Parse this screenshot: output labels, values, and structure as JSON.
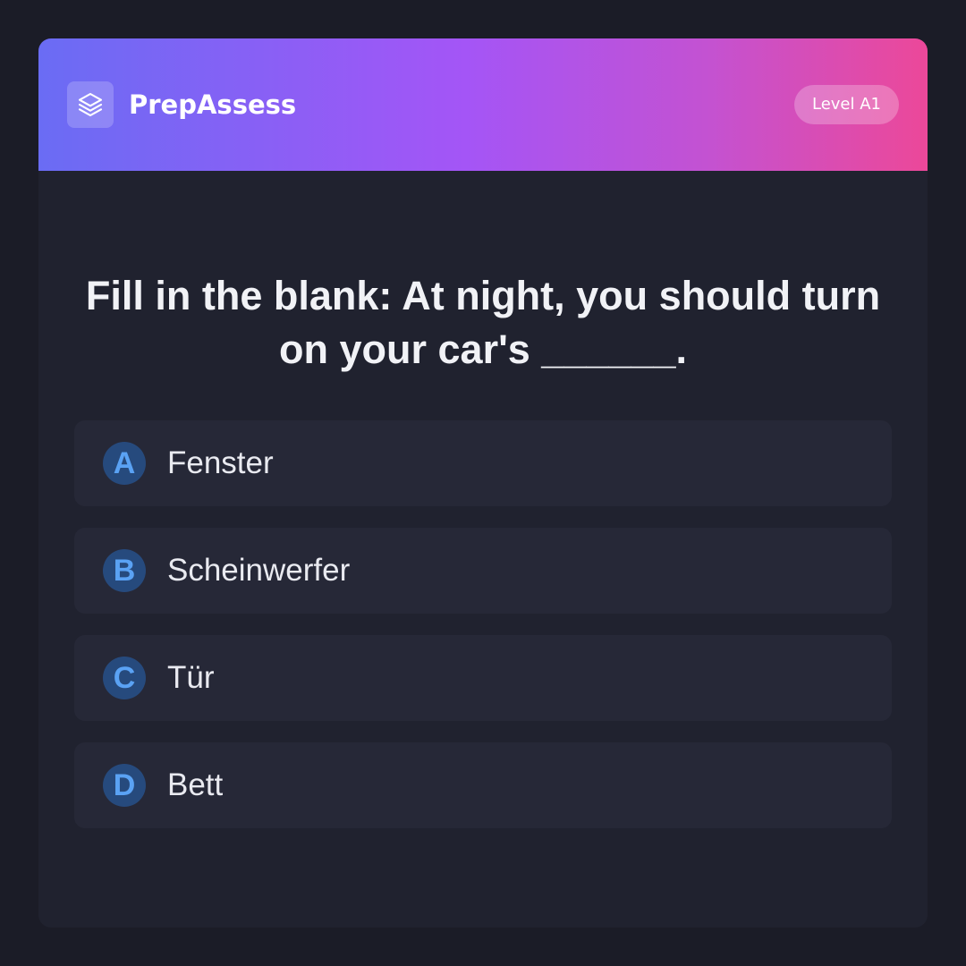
{
  "header": {
    "app_name": "PrepAssess",
    "logo_icon": "layers-icon",
    "level_badge": "Level A1"
  },
  "question": {
    "text": "Fill in the blank: At night, you should turn on your car's ______."
  },
  "options": [
    {
      "letter": "A",
      "text": "Fenster"
    },
    {
      "letter": "B",
      "text": "Scheinwerfer"
    },
    {
      "letter": "C",
      "text": "Tür"
    },
    {
      "letter": "D",
      "text": "Bett"
    }
  ],
  "colors": {
    "page_background": "#1b1c27",
    "card_background": "#20222f",
    "option_background": "#262837",
    "header_gradient": [
      "#6a6cf4",
      "#a455f6",
      "#ec4899"
    ],
    "letter_circle": "#264a7d",
    "letter_text": "#5aa2f4"
  }
}
